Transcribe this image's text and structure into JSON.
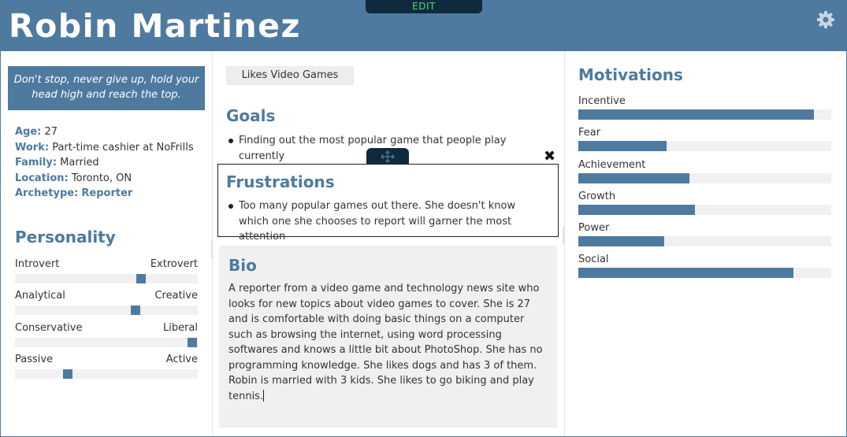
{
  "persona": {
    "name": "Robin Martinez",
    "quote": "Don't stop, never give up, hold your head high and reach the top.",
    "facts": [
      {
        "label": "Age:",
        "value": "27"
      },
      {
        "label": "Work:",
        "value": "Part-time cashier at NoFrills"
      },
      {
        "label": "Family:",
        "value": "Married"
      },
      {
        "label": "Location:",
        "value": "Toronto, ON"
      },
      {
        "label": "Archetype:",
        "value": "Reporter"
      }
    ]
  },
  "toolbar": {
    "edit_label": "EDIT"
  },
  "icons": {
    "settings": "gear-icon",
    "move": "move-arrows-icon",
    "close": "close-icon"
  },
  "personality": {
    "title": "Personality",
    "traits": [
      {
        "left": "Introvert",
        "right": "Extrovert",
        "value": 0.69
      },
      {
        "left": "Analytical",
        "right": "Creative",
        "value": 0.66
      },
      {
        "left": "Conservative",
        "right": "Liberal",
        "value": 0.97
      },
      {
        "left": "Passive",
        "right": "Active",
        "value": 0.29
      }
    ]
  },
  "interests": {
    "tag": "Likes Video Games"
  },
  "goals": {
    "title": "Goals",
    "items": [
      "Finding out the most popular game that people play currently"
    ]
  },
  "frustrations": {
    "title": "Frustrations",
    "items": [
      "Too many popular games out there. She doesn't know which one she chooses to report will garner the most attention"
    ]
  },
  "bio": {
    "title": "Bio",
    "text": "A reporter from a video game and technology news site who looks for new topics about video games to cover. She is 27 and is comfortable with doing basic things on a computer such as browsing the internet, using word processing softwares and knows a little bit about PhotoShop. She has no programming knowledge. She likes dogs and has 3 of them. Robin is married with 3 kids. She likes to go biking and play tennis."
  },
  "motivations": {
    "title": "Motivations",
    "items": [
      {
        "label": "Incentive",
        "value": 0.93
      },
      {
        "label": "Fear",
        "value": 0.35
      },
      {
        "label": "Achievement",
        "value": 0.44
      },
      {
        "label": "Growth",
        "value": 0.46
      },
      {
        "label": "Power",
        "value": 0.34
      },
      {
        "label": "Social",
        "value": 0.85
      }
    ]
  },
  "colors": {
    "accent": "#4e7aa0",
    "dark": "#0f2a3d",
    "edit_text": "#5ecf7a",
    "track": "#f1f1f1"
  }
}
